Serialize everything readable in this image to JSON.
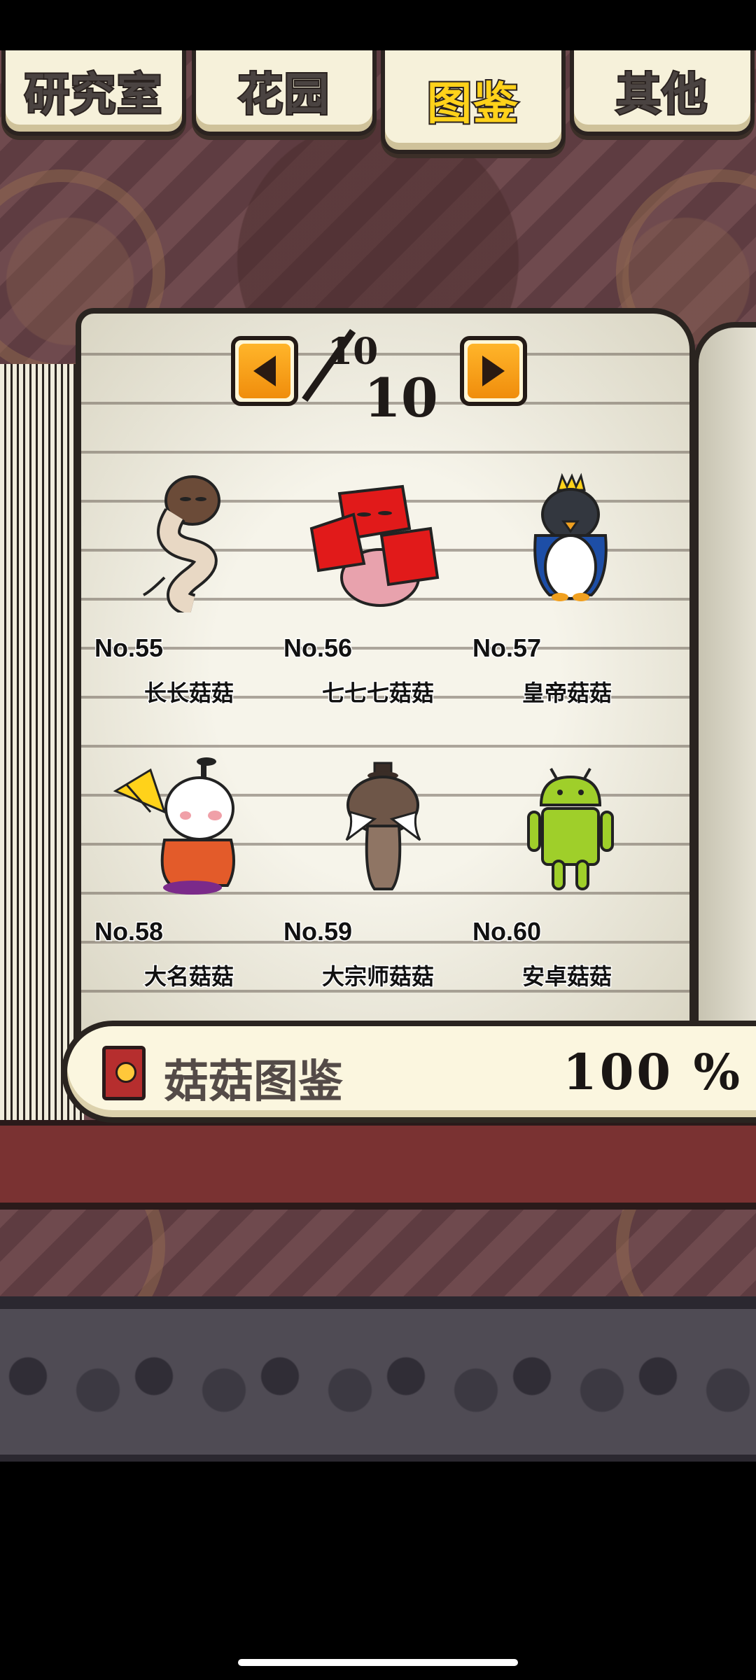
{
  "tabs": [
    {
      "label": "研究室",
      "active": false
    },
    {
      "label": "花园",
      "active": false
    },
    {
      "label": "图鉴",
      "active": true
    },
    {
      "label": "其他",
      "active": false
    }
  ],
  "pager": {
    "current": "10",
    "total": "10"
  },
  "entries": [
    {
      "number": "No.55",
      "name": "长长菇菇",
      "icon": "long-mushroom-icon"
    },
    {
      "number": "No.56",
      "name": "七七七菇菇",
      "icon": "red-777-mushroom-icon"
    },
    {
      "number": "No.57",
      "name": "皇帝菇菇",
      "icon": "emperor-penguin-mushroom-icon"
    },
    {
      "number": "No.58",
      "name": "大名菇菇",
      "icon": "daimyo-mushroom-icon"
    },
    {
      "number": "No.59",
      "name": "大宗师菇菇",
      "icon": "grandmaster-mushroom-icon"
    },
    {
      "number": "No.60",
      "name": "安卓菇菇",
      "icon": "android-mushroom-icon"
    }
  ],
  "footer": {
    "label": "菇菇图鉴",
    "value": "100 %"
  },
  "colors": {
    "active_tab_text": "#ffd21a",
    "page_button": "#f08d0c",
    "cover": "#7a3232"
  }
}
